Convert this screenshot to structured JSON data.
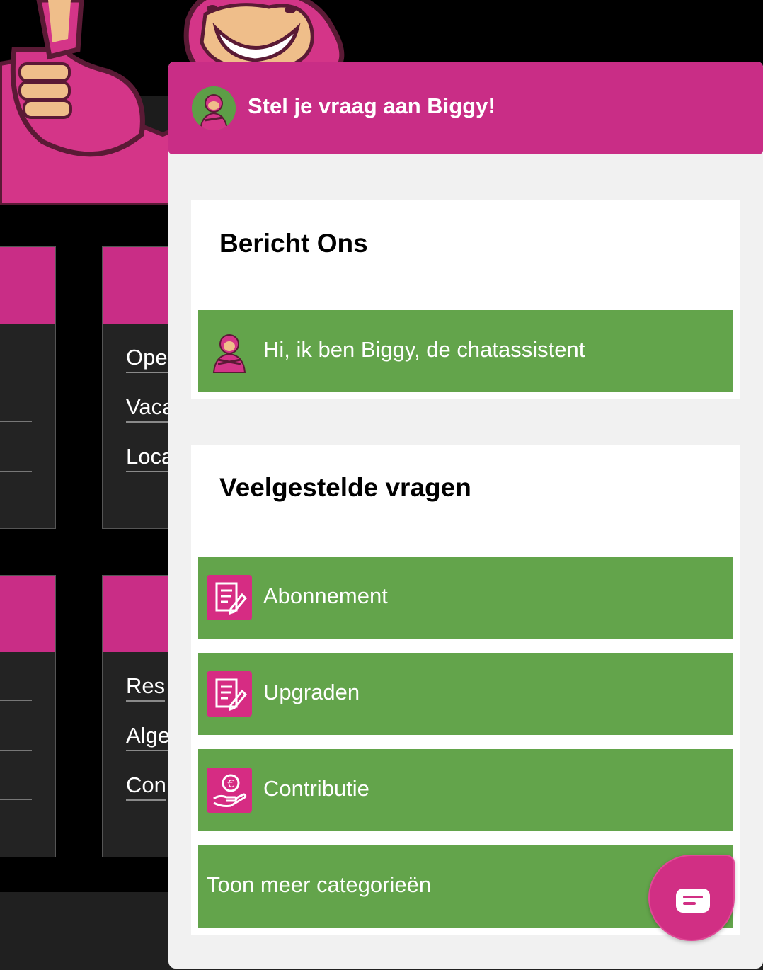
{
  "background": {
    "mascot_name": "gorilla-thumbs-up-icon",
    "cards_top": {
      "right": {
        "links": [
          "Ope",
          "Vaca",
          "Loca"
        ]
      }
    },
    "cards_bottom": {
      "right": {
        "links": [
          "Res",
          "Alge",
          "Con"
        ]
      }
    }
  },
  "widget": {
    "header_title": "Stel je vraag aan Biggy!",
    "message_panel": {
      "title": "Bericht Ons",
      "chat_button_label": "Hi, ik ben Biggy, de chatassistent"
    },
    "faq_panel": {
      "title": "Veelgestelde vragen",
      "items": [
        {
          "label": "Abonnement",
          "icon": "document-edit-icon"
        },
        {
          "label": "Upgraden",
          "icon": "document-edit-icon"
        },
        {
          "label": "Contributie",
          "icon": "euro-hand-icon"
        }
      ],
      "more_label": "Toon meer categorieën"
    },
    "launcher_icon": "chat-bubble-icon"
  },
  "colors": {
    "brand_pink": "#c92d86",
    "green": "#63a44b",
    "panel_bg": "#f1f1f1",
    "dark_bg": "#232323"
  }
}
